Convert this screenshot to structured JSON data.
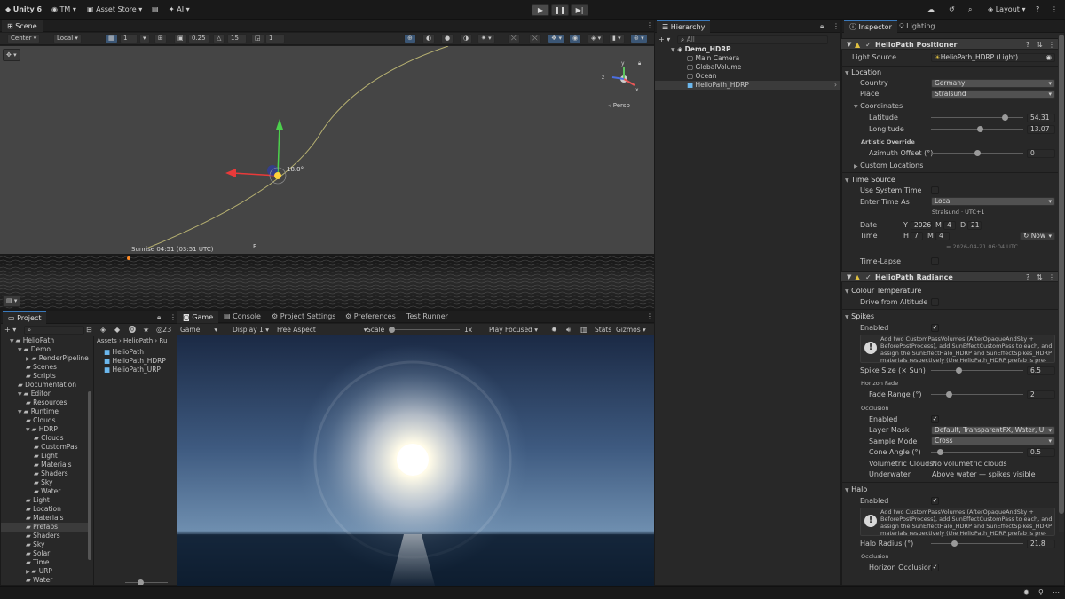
{
  "topbar": {
    "unity": "Unity 6",
    "account": "TM",
    "asset_store": "Asset Store",
    "ai": "AI",
    "layout": "Layout"
  },
  "scene": {
    "tab": "Scene",
    "pivot": "Center",
    "space": "Local",
    "grid_count": "1",
    "snap_value": "0.25",
    "angle_value": "15",
    "scale_value": "1",
    "persp": "Persp",
    "angle_label": "18.0°",
    "sunrise_label": "Sunrise 04:51 (03:51 UTC)",
    "east_marker": "E"
  },
  "hierarchy": {
    "tab": "Hierarchy",
    "search_placeholder": "All",
    "root": "Demo_HDRP",
    "items": [
      "Main Camera",
      "GlobalVolume",
      "Ocean",
      "HelioPath_HDRP"
    ]
  },
  "inspector": {
    "tabs": [
      "Inspector",
      "Lighting"
    ],
    "positioner": {
      "title": "HelioPath Positioner",
      "light_source_label": "Light Source",
      "light_source_value": "HelioPath_HDRP (Light)",
      "location_header": "Location",
      "country_label": "Country",
      "country_value": "Germany",
      "place_label": "Place",
      "place_value": "Stralsund",
      "coords_header": "Coordinates",
      "latitude_label": "Latitude",
      "latitude_value": "54.31",
      "latitude_fraction": 0.8,
      "longitude_label": "Longitude",
      "longitude_value": "13.07",
      "longitude_fraction": 0.53,
      "artistic_label": "Artistic Override",
      "azimuth_label": "Azimuth Offset (°)",
      "azimuth_value": "0",
      "azimuth_fraction": 0.5,
      "custom_locations": "Custom Locations",
      "time_source_header": "Time Source",
      "use_system_time": "Use System Time",
      "enter_time_as": "Enter Time As",
      "enter_time_value": "Local",
      "tz_note": "Stralsund · UTC+1",
      "date_label": "Date",
      "y_label": "Y",
      "year": "2026",
      "m_label": "M",
      "month": "4",
      "d_label": "D",
      "day": "21",
      "time_label": "Time",
      "h_label": "H",
      "hour": "7",
      "min_label": "M",
      "minute": "4",
      "now_button": "Now",
      "timestamp_note": "= 2026-04-21 06:04 UTC",
      "time_lapse": "Time-Lapse"
    },
    "radiance": {
      "title": "HelioPath Radiance",
      "colour_header": "Colour Temperature",
      "drive_from_altitude": "Drive from Altitude",
      "spikes_header": "Spikes",
      "enabled_label": "Enabled",
      "help_text": "Add two CustomPassVolumes (AfterOpaqueAndSky + BeforePostProcess), add SunEffectCustomPass to each, and assign the SunEffectHalo_HDRP and SunEffectSpikes_HDRP materials respectively (the HelioPath_HDRP prefab is pre-wired).",
      "spike_size_label": "Spike Size (× Sun)",
      "spike_size_value": "6.5",
      "spike_size_fraction": 0.3,
      "horizon_fade_label": "Horizon Fade",
      "fade_range_label": "Fade Range (°)",
      "fade_range_value": "2",
      "fade_range_fraction": 0.2,
      "occlusion_label": "Occlusion",
      "occ_enabled_label": "Enabled",
      "layer_mask_label": "Layer Mask",
      "layer_mask_value": "Default, TransparentFX, Water, UI",
      "sample_mode_label": "Sample Mode",
      "sample_mode_value": "Cross",
      "cone_angle_label": "Cone Angle (°)",
      "cone_angle_value": "0.5",
      "cone_angle_fraction": 0.1,
      "vol_clouds_label": "Volumetric Clouds",
      "vol_clouds_value": "No volumetric clouds",
      "underwater_label": "Underwater",
      "underwater_value": "Above water — spikes visible",
      "halo_header": "Halo",
      "halo_enabled_label": "Enabled",
      "halo_radius_label": "Halo Radius (°)",
      "halo_radius_value": "21.8",
      "halo_radius_fraction": 0.25,
      "halo_occlusion_label": "Occlusion",
      "horizon_occlusion_label": "Horizon Occlusion"
    }
  },
  "project": {
    "tab": "Project",
    "count": "23",
    "breadcrumb": [
      "Assets",
      "HelioPath",
      "Ru"
    ],
    "tree": [
      {
        "label": "HelioPath",
        "depth": 0,
        "open": true
      },
      {
        "label": "Demo",
        "depth": 1,
        "open": true
      },
      {
        "label": "RenderPipeline",
        "depth": 2,
        "open": false
      },
      {
        "label": "Scenes",
        "depth": 2
      },
      {
        "label": "Scripts",
        "depth": 2
      },
      {
        "label": "Documentation",
        "depth": 1
      },
      {
        "label": "Editor",
        "depth": 1,
        "open": true
      },
      {
        "label": "Resources",
        "depth": 2
      },
      {
        "label": "Runtime",
        "depth": 1,
        "open": true
      },
      {
        "label": "Clouds",
        "depth": 2
      },
      {
        "label": "HDRP",
        "depth": 2,
        "open": true
      },
      {
        "label": "Clouds",
        "depth": 3
      },
      {
        "label": "CustomPas",
        "depth": 3
      },
      {
        "label": "Light",
        "depth": 3
      },
      {
        "label": "Materials",
        "depth": 3
      },
      {
        "label": "Shaders",
        "depth": 3
      },
      {
        "label": "Sky",
        "depth": 3
      },
      {
        "label": "Water",
        "depth": 3
      },
      {
        "label": "Light",
        "depth": 2
      },
      {
        "label": "Location",
        "depth": 2
      },
      {
        "label": "Materials",
        "depth": 2
      },
      {
        "label": "Prefabs",
        "depth": 2,
        "selected": true
      },
      {
        "label": "Shaders",
        "depth": 2
      },
      {
        "label": "Sky",
        "depth": 2
      },
      {
        "label": "Solar",
        "depth": 2
      },
      {
        "label": "Time",
        "depth": 2
      },
      {
        "label": "URP",
        "depth": 2,
        "open": false
      },
      {
        "label": "Water",
        "depth": 2
      }
    ],
    "assets": [
      "HelioPath",
      "HelioPath_HDRP",
      "HelioPath_URP"
    ]
  },
  "game": {
    "tabs": [
      "Game",
      "Console",
      "Project Settings",
      "Preferences",
      "Test Runner"
    ],
    "mode": "Game",
    "display": "Display 1",
    "aspect": "Free Aspect",
    "scale_label": "Scale",
    "scale_value": "1x",
    "play_mode": "Play Focused",
    "stats": "Stats",
    "gizmos": "Gizmos"
  }
}
